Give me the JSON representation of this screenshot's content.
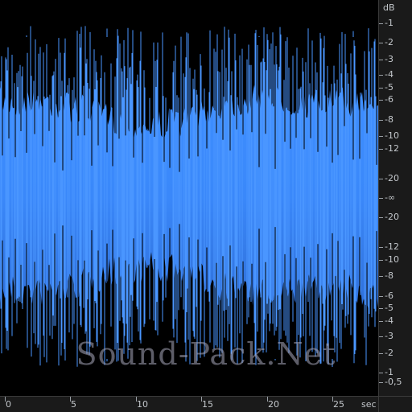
{
  "waveform": {
    "fill_color_top": "#3e8eff",
    "fill_color_bottom": "#2f6fd8",
    "background": "#000000",
    "duration_sec": 28
  },
  "db_scale": {
    "unit_label": "dB",
    "ticks": [
      {
        "label": "-1",
        "v": 1
      },
      {
        "label": "-2",
        "v": 2
      },
      {
        "label": "-3",
        "v": 3
      },
      {
        "label": "-4",
        "v": 4
      },
      {
        "label": "-5",
        "v": 5
      },
      {
        "label": "-6",
        "v": 6
      },
      {
        "label": "-8",
        "v": 8
      },
      {
        "label": "-10",
        "v": 10
      },
      {
        "label": "-12",
        "v": 12
      },
      {
        "label": "-20",
        "v": 20
      },
      {
        "label": "-∞",
        "v": 99
      },
      {
        "label": "-20",
        "v": -20
      },
      {
        "label": "-12",
        "v": -12
      },
      {
        "label": "-10",
        "v": -10
      },
      {
        "label": "-8",
        "v": -8
      },
      {
        "label": "-6",
        "v": -6
      },
      {
        "label": "-5",
        "v": -5
      },
      {
        "label": "-4",
        "v": -4
      },
      {
        "label": "-3",
        "v": -3
      },
      {
        "label": "-2",
        "v": -2
      },
      {
        "label": "-1",
        "v": -1
      },
      {
        "label": "-0,5",
        "v": -0.5
      }
    ]
  },
  "time_axis": {
    "unit_label": "sec",
    "ticks": [
      {
        "label": "0",
        "t": 0
      },
      {
        "label": "5",
        "t": 5
      },
      {
        "label": "10",
        "t": 10
      },
      {
        "label": "15",
        "t": 15
      },
      {
        "label": "20",
        "t": 20
      },
      {
        "label": "25",
        "t": 25
      }
    ]
  },
  "watermark": {
    "text": "Sound-Pack.Net"
  }
}
